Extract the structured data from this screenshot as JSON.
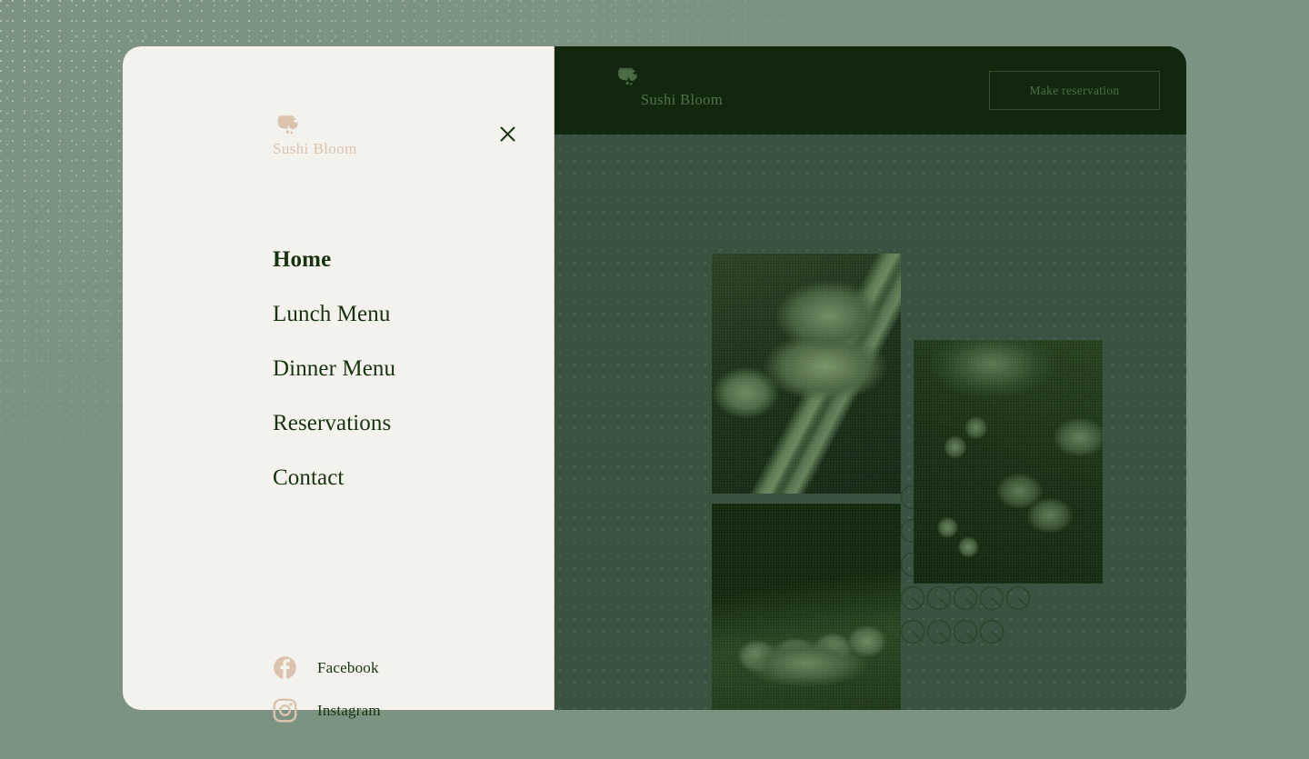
{
  "brand": {
    "name": "Sushi Bloom",
    "mark_icon": "shrimp-icon",
    "drawer_name_color": "#dcc3ae",
    "header_name_color": "#51704a"
  },
  "header": {
    "reserve_button_label": "Make reservation",
    "background_color": "#11280f"
  },
  "drawer": {
    "close_icon": "close-icon",
    "background_color": "#f4f2ec",
    "nav_items": [
      {
        "label": "Home",
        "active": true
      },
      {
        "label": "Lunch Menu",
        "active": false
      },
      {
        "label": "Dinner Menu",
        "active": false
      },
      {
        "label": "Reservations",
        "active": false
      },
      {
        "label": "Contact",
        "active": false
      }
    ],
    "social_items": [
      {
        "label": "Facebook",
        "icon": "facebook-icon"
      },
      {
        "label": "Instagram",
        "icon": "instagram-icon"
      }
    ]
  },
  "gallery": {
    "photos": [
      {
        "name": "sushi-plate-photo"
      },
      {
        "name": "sushi-board-photo"
      },
      {
        "name": "sushi-tray-photo"
      }
    ],
    "decoration": "circle-lattice-pattern"
  },
  "palette": {
    "page_background": "#7d9382",
    "card_background": "#3a5340",
    "header_dark": "#11280f",
    "accent_tan": "#dcc3ae",
    "text_dark_green": "#17320f"
  }
}
